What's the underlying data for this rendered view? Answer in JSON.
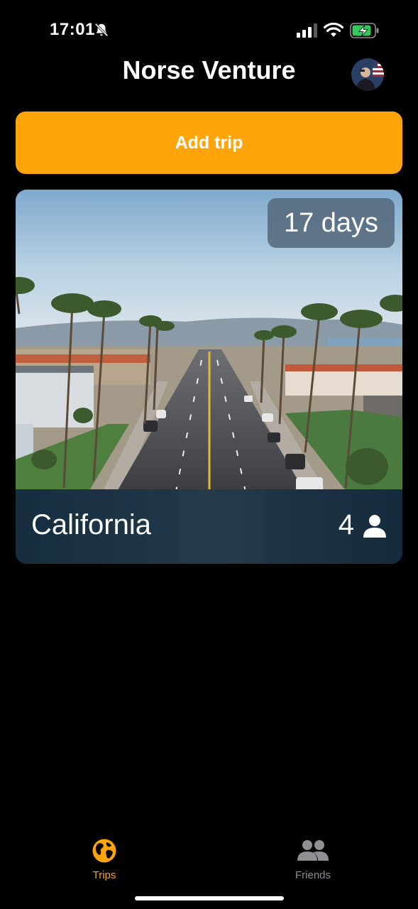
{
  "status_bar": {
    "time": "17:01",
    "icons": [
      "bell-slash-icon",
      "signal-icon",
      "wifi-icon",
      "battery-charging-icon"
    ]
  },
  "header": {
    "title": "Norse Venture",
    "avatar_icon": "user-avatar"
  },
  "actions": {
    "add_trip_label": "Add trip"
  },
  "trips": [
    {
      "name": "California",
      "duration": "17 days",
      "members": "4",
      "members_icon": "person-icon",
      "photo": "palm-lined-street-photo"
    }
  ],
  "tab_bar": {
    "tabs": [
      {
        "label": "Trips",
        "icon": "globe-icon",
        "active": true
      },
      {
        "label": "Friends",
        "icon": "people-icon",
        "active": false
      }
    ]
  },
  "colors": {
    "accent": "#FFA40A",
    "background": "#000000",
    "inactive_tab": "#8E8E93",
    "battery_green": "#34C759"
  }
}
